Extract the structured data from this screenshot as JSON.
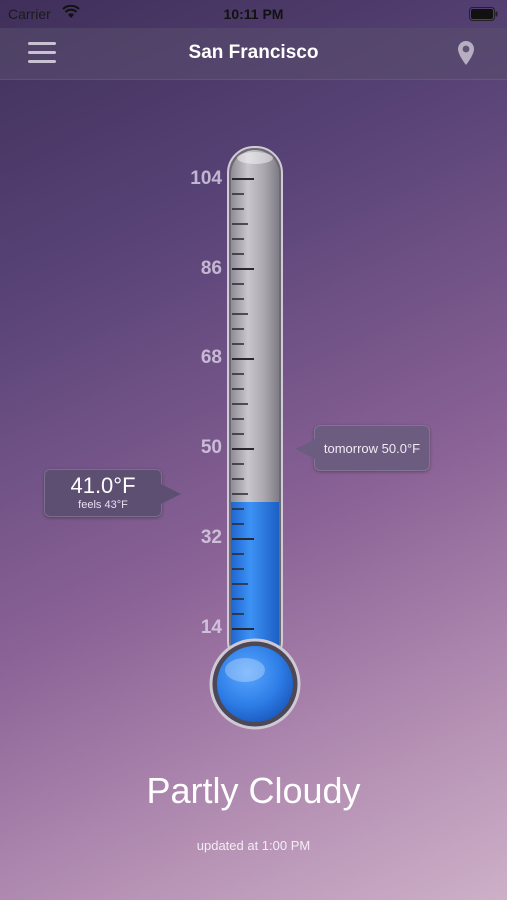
{
  "status_bar": {
    "carrier": "Carrier",
    "time": "10:11 PM"
  },
  "nav": {
    "title": "San Francisco",
    "menu_icon": "hamburger-menu-icon",
    "location_icon": "map-pin-icon"
  },
  "thermometer": {
    "scale_labels": [
      "104",
      "86",
      "68",
      "50",
      "32",
      "14"
    ],
    "scale_values": [
      104,
      86,
      68,
      50,
      32,
      14
    ],
    "current_value": 41.0,
    "fill_color": "#2f82f0",
    "tube_color": "#a9a6ad"
  },
  "current": {
    "temp": "41.0°F",
    "feels": "feels 43°F"
  },
  "tomorrow": {
    "text": "tomorrow 50.0°F"
  },
  "weather": {
    "condition": "Partly Cloudy",
    "updated": "updated at 1:00 PM"
  }
}
